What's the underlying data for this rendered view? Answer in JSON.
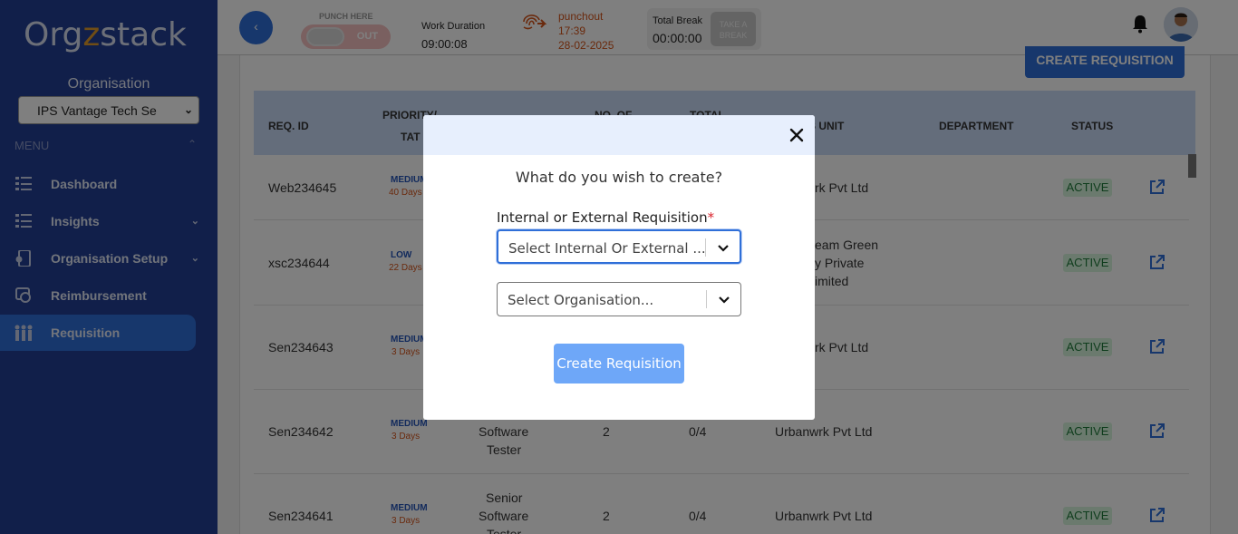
{
  "brand": {
    "logo_part1": "Org",
    "logo_accent": "z",
    "logo_part2": "stack"
  },
  "sidebar": {
    "org_label": "Organisation",
    "org_selected": "IPS Vantage Tech Se",
    "menu_label": "MENU",
    "items": [
      {
        "label": "Dashboard",
        "icon": "dashboard-icon"
      },
      {
        "label": "Insights",
        "icon": "insights-icon"
      },
      {
        "label": "Organisation Setup",
        "icon": "organisation-setup-icon"
      },
      {
        "label": "Reimbursement",
        "icon": "reimbursement-icon"
      },
      {
        "label": "Requisition",
        "icon": "requisition-icon"
      }
    ],
    "colors": {
      "background": "#223f94",
      "active": "#2f6fd8"
    }
  },
  "topbar": {
    "punch_here": "PUNCH HERE",
    "punch_state": "OUT",
    "work_duration_label": "Work Duration",
    "work_duration_value": "09:00:08",
    "punchout_label": "punchout",
    "punchout_time": "17:39",
    "punchout_date": "28-02-2025",
    "total_break_label": "Total Break",
    "total_break_value": "00:00:00",
    "take_break_line1": "TAKE A",
    "take_break_line2": "BREAK"
  },
  "page": {
    "create_button": "CREATE REQUISITION",
    "columns": [
      "REQ. ID",
      "PRIORITY/",
      "TAT",
      "NO. OF",
      "TOTAL",
      "BUSINESS UNIT",
      "DEPARTMENT",
      "STATUS"
    ],
    "columns_visible": {
      "business_unit": "INESS UNIT"
    },
    "rows": [
      {
        "id": "Web234645",
        "priority": "MEDIUM",
        "tat": "40 Days",
        "business_unit": "rk Pvt Ltd",
        "status": "ACTIVE"
      },
      {
        "id": "xsc234644",
        "priority": "LOW",
        "tat": "22 Days",
        "bu_line1": "eam Green",
        "bu_line2": "y Private",
        "bu_line3": "imited",
        "status": "ACTIVE"
      },
      {
        "id": "Sen234643",
        "priority": "MEDIUM",
        "tat": "3 Days",
        "business_unit": "rk Pvt Ltd",
        "status": "ACTIVE"
      },
      {
        "id": "Sen234642",
        "priority": "MEDIUM",
        "tat": "3 Days",
        "role_line1": "Software",
        "role_line2": "Tester",
        "positions": "2",
        "total": "0/4",
        "business_unit": "Urbanwrk Pvt Ltd",
        "status": "ACTIVE"
      },
      {
        "id": "Sen234641",
        "priority": "MEDIUM",
        "tat": "3 Days",
        "role_line1": "Senior",
        "role_line2": "Software",
        "role_line3": "Tester",
        "positions": "2",
        "total": "0/4",
        "business_unit": "Urbanwrk Pvt Ltd",
        "status": "ACTIVE"
      }
    ]
  },
  "modal": {
    "title": "What do you wish to create?",
    "field_label": "Internal or External Requisition",
    "required_mark": "*",
    "select1_placeholder": "Select Internal Or External ...",
    "select2_placeholder": "Select Organisation...",
    "submit": "Create Requisition"
  }
}
